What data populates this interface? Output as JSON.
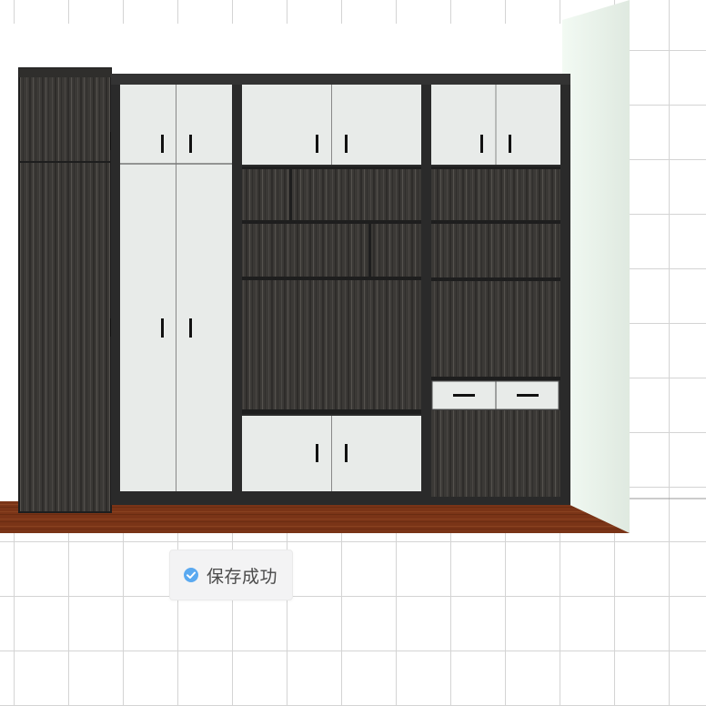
{
  "toast": {
    "icon": "check-circle-icon",
    "message": "保存成功",
    "icon_color": "#5aa9f0"
  },
  "colors": {
    "wood_dark": "#3a3836",
    "frame": "#2a2a2a",
    "door_white": "#e9ecea",
    "floor": "#7a3516",
    "wall_right": "#e4f0e6"
  }
}
